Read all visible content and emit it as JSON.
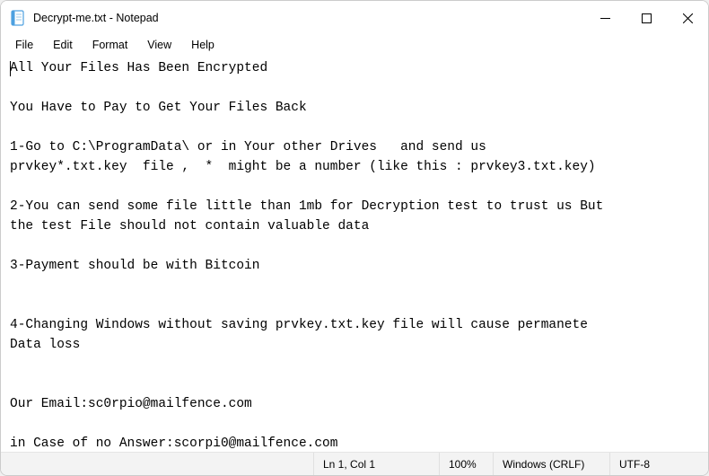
{
  "titlebar": {
    "title": "Decrypt-me.txt - Notepad"
  },
  "menu": {
    "file": "File",
    "edit": "Edit",
    "format": "Format",
    "view": "View",
    "help": "Help"
  },
  "content": {
    "text": "All Your Files Has Been Encrypted\n\nYou Have to Pay to Get Your Files Back\n\n1-Go to C:\\ProgramData\\ or in Your other Drives   and send us\nprvkey*.txt.key  file ,  *  might be a number (like this : prvkey3.txt.key)\n\n2-You can send some file little than 1mb for Decryption test to trust us But\nthe test File should not contain valuable data\n\n3-Payment should be with Bitcoin\n\n\n4-Changing Windows without saving prvkey.txt.key file will cause permanete\nData loss\n\n\nOur Email:sc0rpio@mailfence.com\n\nin Case of no Answer:scorpi0@mailfence.com"
  },
  "statusbar": {
    "position": "Ln 1, Col 1",
    "zoom": "100%",
    "line_ending": "Windows (CRLF)",
    "encoding": "UTF-8"
  },
  "icons": {
    "notepad": "notepad-icon",
    "minimize": "minimize-icon",
    "maximize": "maximize-icon",
    "close": "close-icon"
  }
}
